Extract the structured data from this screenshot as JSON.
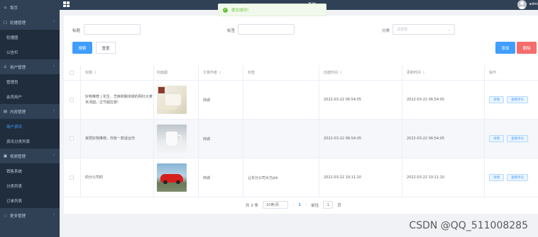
{
  "topbar": {
    "system_title": "系统",
    "user": "admi"
  },
  "toast": {
    "message": "提交成功!"
  },
  "sidebar": {
    "items": [
      {
        "label": "首页",
        "type": "top"
      },
      {
        "label": "轮播管理",
        "type": "top"
      },
      {
        "label": "轮播图",
        "type": "sub"
      },
      {
        "label": "公告栏",
        "type": "sub"
      },
      {
        "label": "用户管理",
        "type": "top"
      },
      {
        "label": "管理员",
        "type": "sub"
      },
      {
        "label": "会员用户",
        "type": "sub"
      },
      {
        "label": "内容管理",
        "type": "top"
      },
      {
        "label": "商户资讯",
        "type": "sub",
        "active": true
      },
      {
        "label": "资讯分类列表",
        "type": "sub"
      },
      {
        "label": "视频管理",
        "type": "top"
      },
      {
        "label": "销售系统",
        "type": "sub"
      },
      {
        "label": "分类列表",
        "type": "sub"
      },
      {
        "label": "订单列表",
        "type": "sub"
      },
      {
        "label": "更多管理",
        "type": "top"
      }
    ]
  },
  "filters": {
    "title_label": "标题",
    "tag_label": "标签",
    "category_label": "分类",
    "category_placeholder": "请选择"
  },
  "buttons": {
    "search": "搜索",
    "reset": "重置",
    "add": "添加",
    "delete": "删除"
  },
  "table": {
    "headers": [
      "标题",
      "封面图",
      "文章作者",
      "标签",
      "创建时间",
      "更新时间",
      "操作"
    ],
    "rows": [
      {
        "title": "好物推荐 | 花生、芝麻和糯米做的网红大黄米汤圆，过节超应景!",
        "author": "商城",
        "tag": "",
        "created": "2022-03-22 06:54:05",
        "updated": "2022-03-22 06:54:05"
      },
      {
        "title": "家居好物推荐，你有一款适合你",
        "author": "商城",
        "tag": "",
        "created": "2022-03-22 06:54:05",
        "updated": "2022-03-22 06:54:05"
      },
      {
        "title": "的分公司的",
        "author": "商城",
        "tag": "让东分公司大方plk",
        "created": "2022-03-22 10:11:10",
        "updated": "2022-03-22 10:11:10"
      }
    ],
    "op_detail": "详情",
    "op_comment": "查看评论"
  },
  "pagination": {
    "total": "共 3 条",
    "page_size": "10条/页",
    "prev": "‹",
    "current": "1",
    "next": "›",
    "goto": "前往",
    "goto_value": "1",
    "page_unit": "页"
  },
  "watermark": "CSDN @QQ_511008285"
}
